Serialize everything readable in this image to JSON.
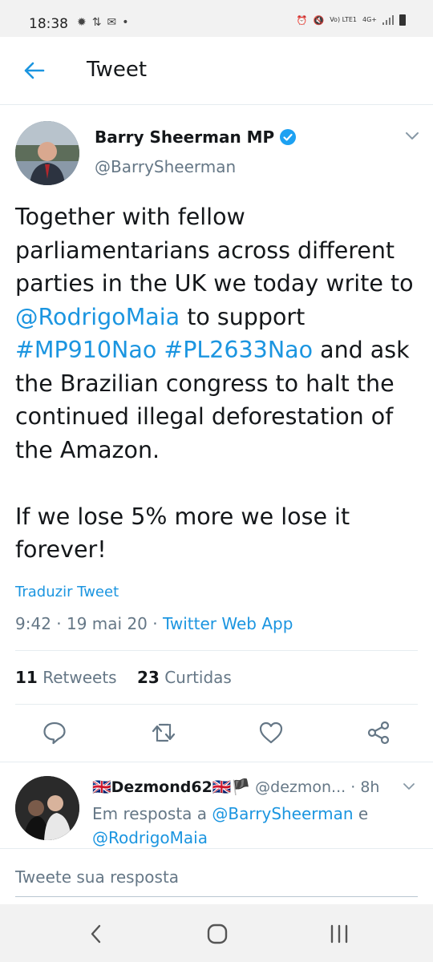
{
  "status_bar": {
    "time": "18:38",
    "volte": "Vo) LTE1",
    "network": "4G+"
  },
  "header": {
    "title": "Tweet"
  },
  "tweet": {
    "author_name": "Barry Sheerman MP",
    "author_handle": "@BarrySheerman",
    "verified": true,
    "text_1": "Together with fellow parliamentarians across different parties in the UK we today write to ",
    "mention": "@RodrigoMaia",
    "text_2": " to support ",
    "hashtag_1": "#MP910Nao",
    "space": " ",
    "hashtag_2": "#PL2633Nao",
    "text_3": " and ask the Brazilian congress to halt the continued illegal deforestation of the Amazon.",
    "text_4": "If we lose 5% more we lose it forever!",
    "translate_label": "Traduzir Tweet",
    "timestamp": "9:42 · 19 mai 20 · ",
    "source": "Twitter Web App",
    "retweets_count": "11",
    "retweets_label": "Retweets",
    "likes_count": "23",
    "likes_label": "Curtidas"
  },
  "reply": {
    "name": "🇬🇧Dezmond62🇬🇧🏴",
    "handle": "@dezmon...",
    "time": "· 8h",
    "in_reply_prefix": "Em resposta a ",
    "mention_1": "@BarrySheerman",
    "conj": " e",
    "mention_2": "@RodrigoMaia"
  },
  "compose": {
    "placeholder": "Tweete sua resposta"
  },
  "colors": {
    "accent": "#1b95e0",
    "muted": "#657786",
    "text": "#14171a"
  }
}
